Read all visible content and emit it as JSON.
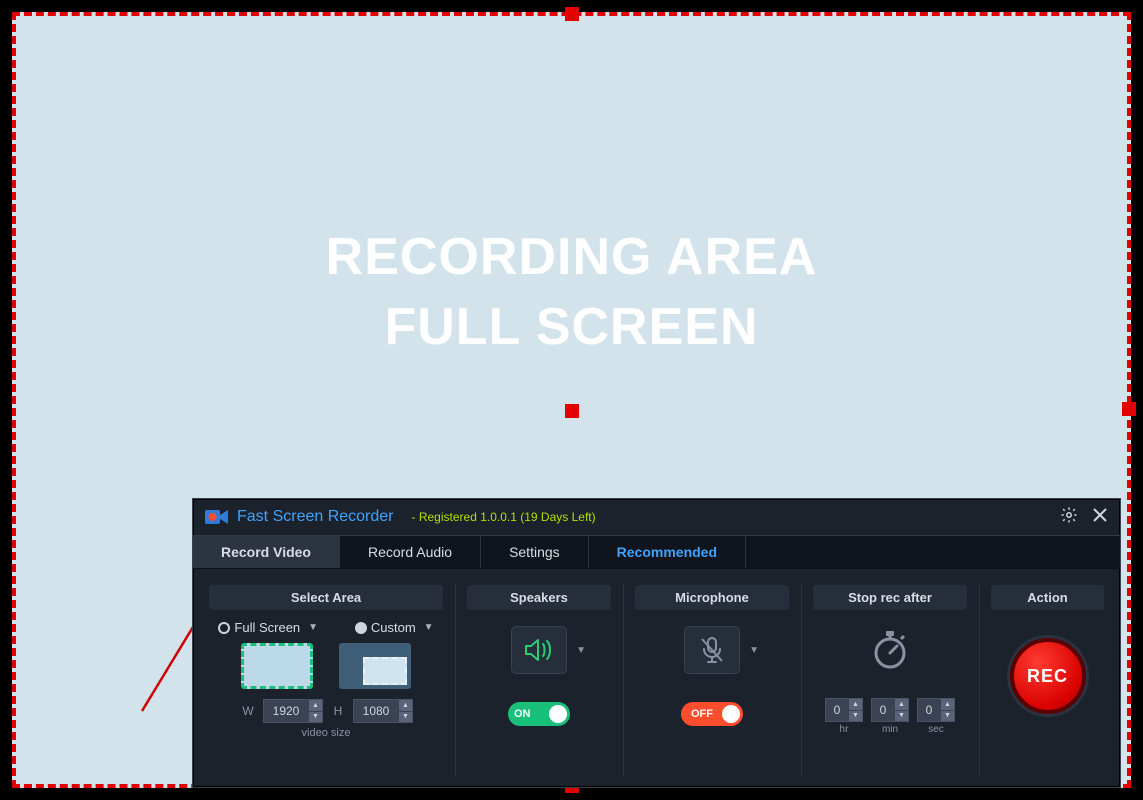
{
  "watermark": {
    "line1": "RECORDING AREA",
    "line2": "FULL SCREEN"
  },
  "titlebar": {
    "app_name": "Fast Screen Recorder",
    "license": "- Registered 1.0.0.1 (19 Days Left)"
  },
  "tabs": {
    "record_video": "Record Video",
    "record_audio": "Record Audio",
    "settings": "Settings",
    "recommended": "Recommended"
  },
  "area": {
    "heading": "Select Area",
    "full_label": "Full Screen",
    "custom_label": "Custom",
    "w_label": "W",
    "h_label": "H",
    "width": "1920",
    "height": "1080",
    "video_size_label": "video size"
  },
  "speakers": {
    "heading": "Speakers",
    "toggle_label": "ON"
  },
  "microphone": {
    "heading": "Microphone",
    "toggle_label": "OFF"
  },
  "stop": {
    "heading": "Stop rec after",
    "hr": "0",
    "min": "0",
    "sec": "0",
    "hr_label": "hr",
    "min_label": "min",
    "sec_label": "sec"
  },
  "action": {
    "heading": "Action",
    "rec_label": "REC"
  }
}
